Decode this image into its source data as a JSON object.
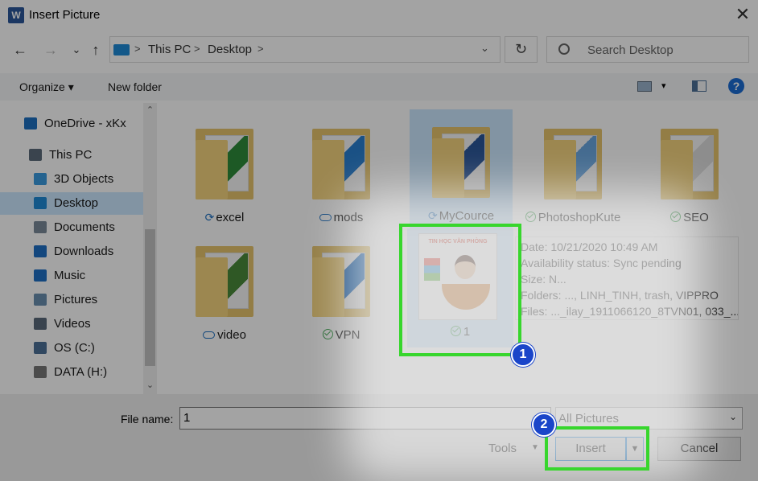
{
  "window": {
    "title": "Insert Picture",
    "app_icon": "W"
  },
  "nav": {
    "back": "←",
    "forward": "→",
    "recent": "⌄",
    "up": "↑"
  },
  "address": {
    "crumbs": [
      "This PC",
      "Desktop"
    ],
    "separator": ">",
    "dropdown": "⌄"
  },
  "refresh_glyph": "↻",
  "search": {
    "placeholder": "Search Desktop"
  },
  "toolbar": {
    "organize": "Organize ▾",
    "new_folder": "New folder",
    "help": "?",
    "view_arrow": "▾"
  },
  "sidebar": {
    "items": [
      {
        "label": "OneDrive - xKx",
        "icon": "cloud-icon",
        "color": "#1d6fc0"
      },
      {
        "label": "This PC",
        "icon": "computer-icon",
        "color": "#5b6b7a"
      },
      {
        "label": "3D Objects",
        "icon": "cube-icon",
        "color": "#3a9be0"
      },
      {
        "label": "Desktop",
        "icon": "desktop-icon",
        "color": "#1f8ad6",
        "selected": true
      },
      {
        "label": "Documents",
        "icon": "document-icon",
        "color": "#7a8a99"
      },
      {
        "label": "Downloads",
        "icon": "download-icon",
        "color": "#1f6fc5"
      },
      {
        "label": "Music",
        "icon": "music-icon",
        "color": "#1f6fc5"
      },
      {
        "label": "Pictures",
        "icon": "picture-icon",
        "color": "#6a8fb0"
      },
      {
        "label": "Videos",
        "icon": "video-icon",
        "color": "#5a6a7a"
      },
      {
        "label": "OS (C:)",
        "icon": "drive-icon",
        "color": "#4b6f96"
      },
      {
        "label": "DATA (H:)",
        "icon": "drive-icon",
        "color": "#777777"
      }
    ],
    "scroll_up": "⌃",
    "scroll_down": "⌄"
  },
  "files": [
    {
      "name": "excel",
      "status": "syncing",
      "accent": "#2e8b3a"
    },
    {
      "name": "mods",
      "status": "cloud",
      "accent": "#2a7fd0"
    },
    {
      "name": "MyCource",
      "status": "syncing",
      "accent": "#2b579a",
      "selected": true
    },
    {
      "name": "PhotoshopKute",
      "status": "ok",
      "accent": "#6aa6e0"
    },
    {
      "name": "SEO",
      "status": "ok",
      "accent": "#dddddd"
    },
    {
      "name": "video",
      "status": "cloud",
      "accent": "#4a8a3a"
    },
    {
      "name": "VPN",
      "status": "ok",
      "accent": "#1f6fc5"
    },
    {
      "name": "1",
      "status": "ok",
      "image": true,
      "image_title": "TIN HỌC VĂN PHÒNG",
      "selected": true
    }
  ],
  "tooltip": {
    "lines": [
      "Date: 10/21/2020 10:49 AM",
      "Availability status: Sync pending",
      "Size: N...",
      "Folders: ..., LINH_TINH, trash, VIPPRO",
      "Files: ..._ilay_1911066120_8TVN01, 033_..."
    ]
  },
  "bottom": {
    "file_name_label": "File name:",
    "file_name_value": "1",
    "file_type": "All Pictures",
    "tools": "Tools",
    "insert": "Insert",
    "cancel": "Cancel",
    "arrow": "▼"
  },
  "annotations": {
    "step1": "1",
    "step2": "2",
    "highlight_color": "#37d62d",
    "badge_color": "#1a45c9"
  }
}
